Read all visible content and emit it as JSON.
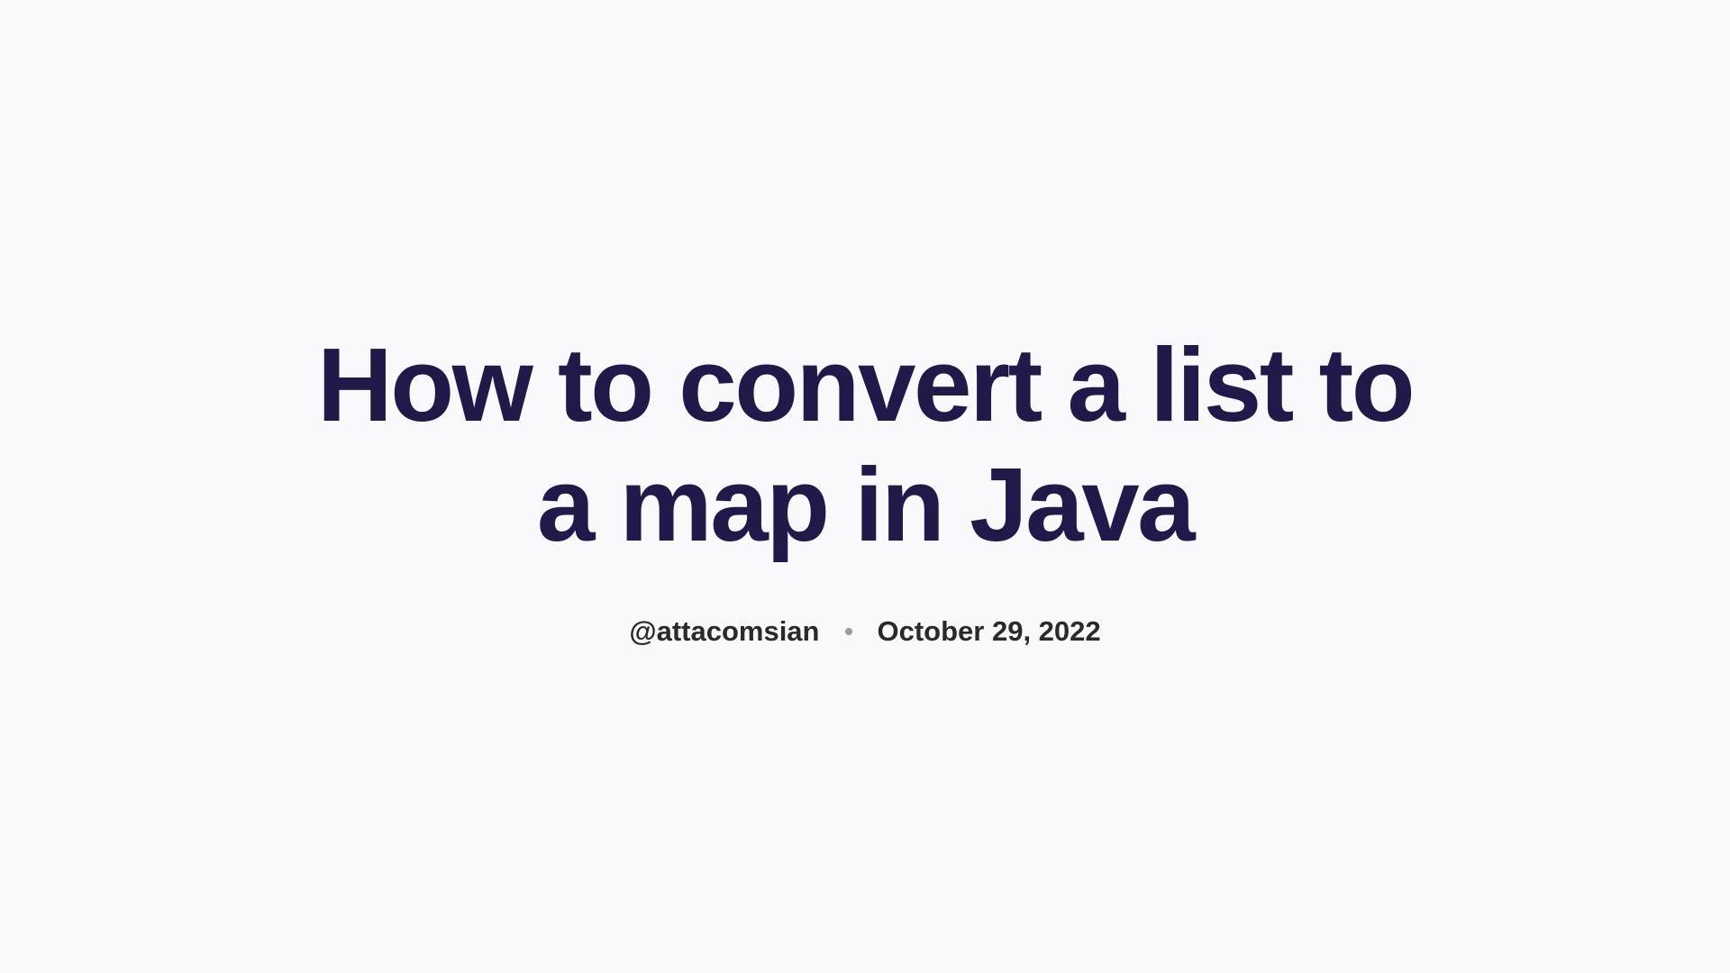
{
  "title": "How to convert a list to a map in Java",
  "meta": {
    "author": "@attacomsian",
    "date": "October 29, 2022"
  }
}
